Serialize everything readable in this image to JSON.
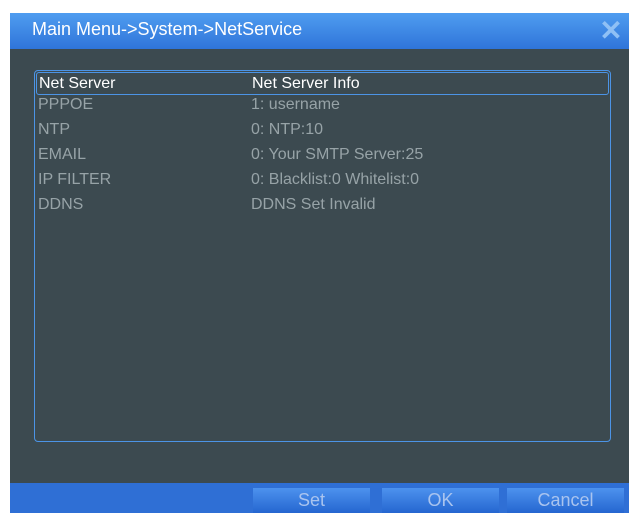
{
  "window": {
    "title": "Main Menu->System->NetService",
    "close_symbol": "✕"
  },
  "table": {
    "columns": [
      "Net Server",
      "Net Server Info"
    ],
    "rows": [
      {
        "server": "PPPOE",
        "info": "1: username"
      },
      {
        "server": "NTP",
        "info": "0: NTP:10"
      },
      {
        "server": "EMAIL",
        "info": "0: Your SMTP Server:25"
      },
      {
        "server": "IP FILTER",
        "info": "0: Blacklist:0 Whitelist:0"
      },
      {
        "server": "DDNS",
        "info": "DDNS Set Invalid"
      }
    ]
  },
  "buttons": {
    "set": "Set",
    "ok": "OK",
    "cancel": "Cancel"
  },
  "colors": {
    "titlebar": "#3d88e6",
    "panel": "#3c4a50",
    "border": "#4c94e6",
    "row_text": "#97a3a7"
  }
}
